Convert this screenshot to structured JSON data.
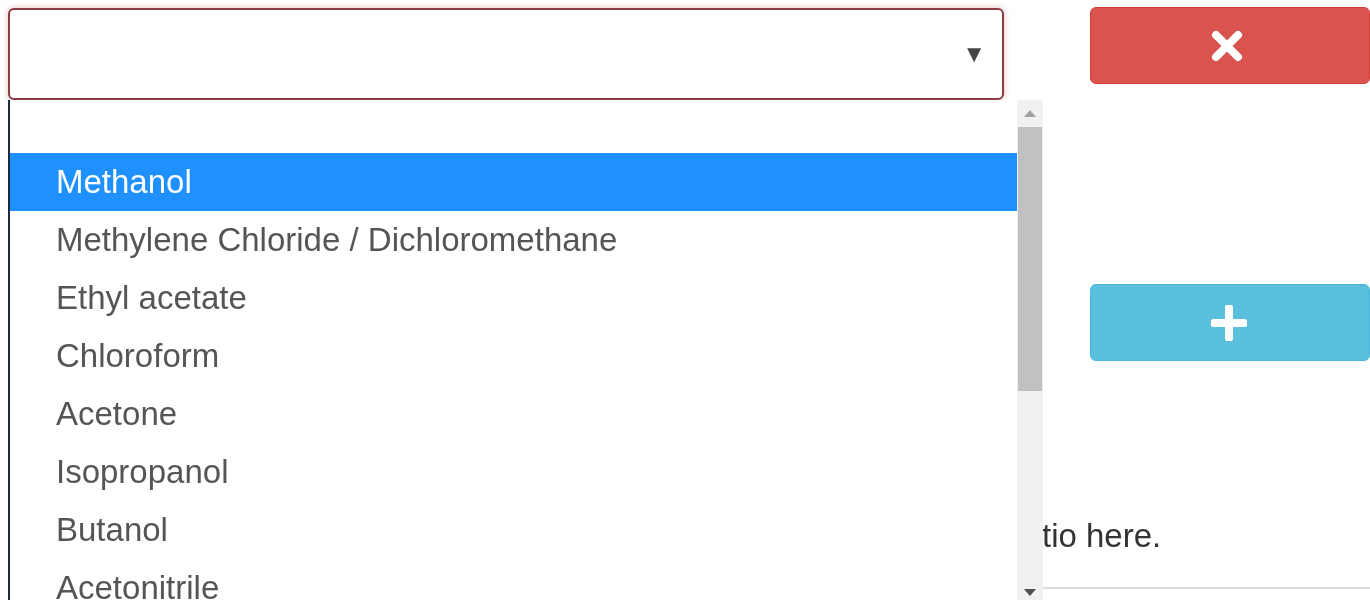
{
  "select": {
    "caret": "▼"
  },
  "options": [
    {
      "label": "Methanol",
      "selected": true
    },
    {
      "label": "Methylene Chloride / Dichloromethane",
      "selected": false
    },
    {
      "label": "Ethyl acetate",
      "selected": false
    },
    {
      "label": "Chloroform",
      "selected": false
    },
    {
      "label": "Acetone",
      "selected": false
    },
    {
      "label": "Isopropanol",
      "selected": false
    },
    {
      "label": "Butanol",
      "selected": false
    },
    {
      "label": "Acetonitrile",
      "selected": false
    }
  ],
  "buttons": [
    {
      "kind": "remove"
    },
    {
      "kind": "add"
    }
  ],
  "hint": "tio here."
}
